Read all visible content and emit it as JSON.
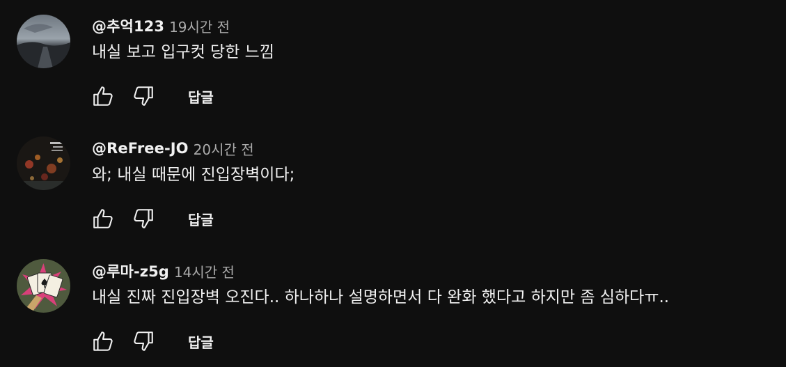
{
  "comments": [
    {
      "author": "@추억123",
      "time": "19시간 전",
      "text": "내실 보고 입구컷 당한 느낌",
      "reply_label": "답글",
      "avatar_icon": "avatar-dark-landscape"
    },
    {
      "author": "@ReFree-JO",
      "time": "20시간 전",
      "text": "와; 내실 때문에 진입장벽이다;",
      "reply_label": "답글",
      "avatar_icon": "avatar-rainy-night-lights"
    },
    {
      "author": "@루마-z5g",
      "time": "14시간 전",
      "text": "내실 진짜 진입장벽 오진다.. 하나하나 설명하면서 다 완화 했다고 하지만 좀 심하다ㅠ..",
      "reply_label": "답글",
      "avatar_icon": "avatar-playing-cards"
    }
  ],
  "colors": {
    "background": "#0f0f0f",
    "primary_text": "#f1f1f1",
    "secondary_text": "#aaaaaa"
  }
}
